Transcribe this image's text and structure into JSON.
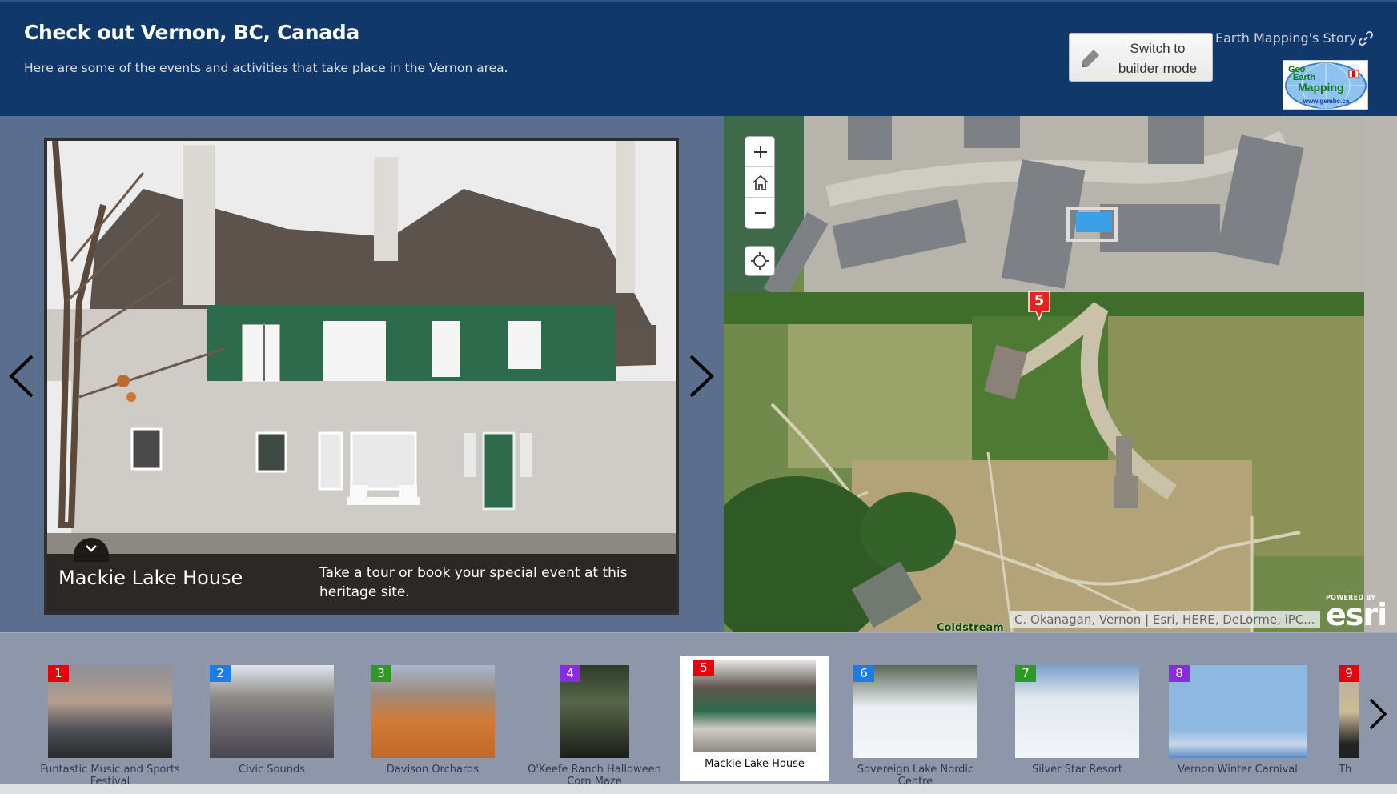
{
  "header": {
    "title": "Check out Vernon, BC, Canada",
    "subtitle": "Here are some of the events and activities that take place in the Vernon area.",
    "builder_button": "Switch to builder mode",
    "builder_button_line1": "Switch to",
    "builder_button_line2": "builder mode",
    "story_link": "Earth Mapping's Story",
    "logo": {
      "line1": "Geo",
      "line2": "Earth",
      "line3": "Mapping",
      "url": "www.gembc.ca"
    }
  },
  "media": {
    "title": "Mackie Lake House",
    "description": "Take a tour or book your special event at this heritage site.",
    "prev_icon": "chevron-left",
    "next_icon": "chevron-right",
    "collapse_icon": "chevron-down"
  },
  "map": {
    "controls": {
      "zoom_in": "+",
      "home": "home-icon",
      "zoom_out": "−",
      "locate": "locate-icon"
    },
    "marker_number": "5",
    "marker_color": "#e8231f",
    "place_label": "Coldstream",
    "attribution": "C. Okanagan, Vernon | Esri, HERE, DeLorme, iPC...",
    "powered_by": "POWERED BY",
    "esri_logo": "esri"
  },
  "carousel": {
    "selected_index": 5,
    "items": [
      {
        "number": "1",
        "label": "Funtastic Music and Sports Festival",
        "color": "#e8000b"
      },
      {
        "number": "2",
        "label": "Civic Sounds",
        "color": "#1a7ee6"
      },
      {
        "number": "3",
        "label": "Davison Orchards",
        "color": "#2e9a26"
      },
      {
        "number": "4",
        "label": "O'Keefe Ranch Halloween Corn Maze",
        "color": "#8a2be2"
      },
      {
        "number": "5",
        "label": "Mackie Lake House",
        "color": "#e8000b"
      },
      {
        "number": "6",
        "label": "Sovereign Lake Nordic Centre",
        "color": "#1a7ee6"
      },
      {
        "number": "7",
        "label": "Silver Star Resort",
        "color": "#2e9a26"
      },
      {
        "number": "8",
        "label": "Vernon Winter Carnival",
        "color": "#8a2be2"
      },
      {
        "number": "9",
        "label": "Th",
        "color": "#e8000b"
      }
    ],
    "next_icon": "chevron-right"
  }
}
